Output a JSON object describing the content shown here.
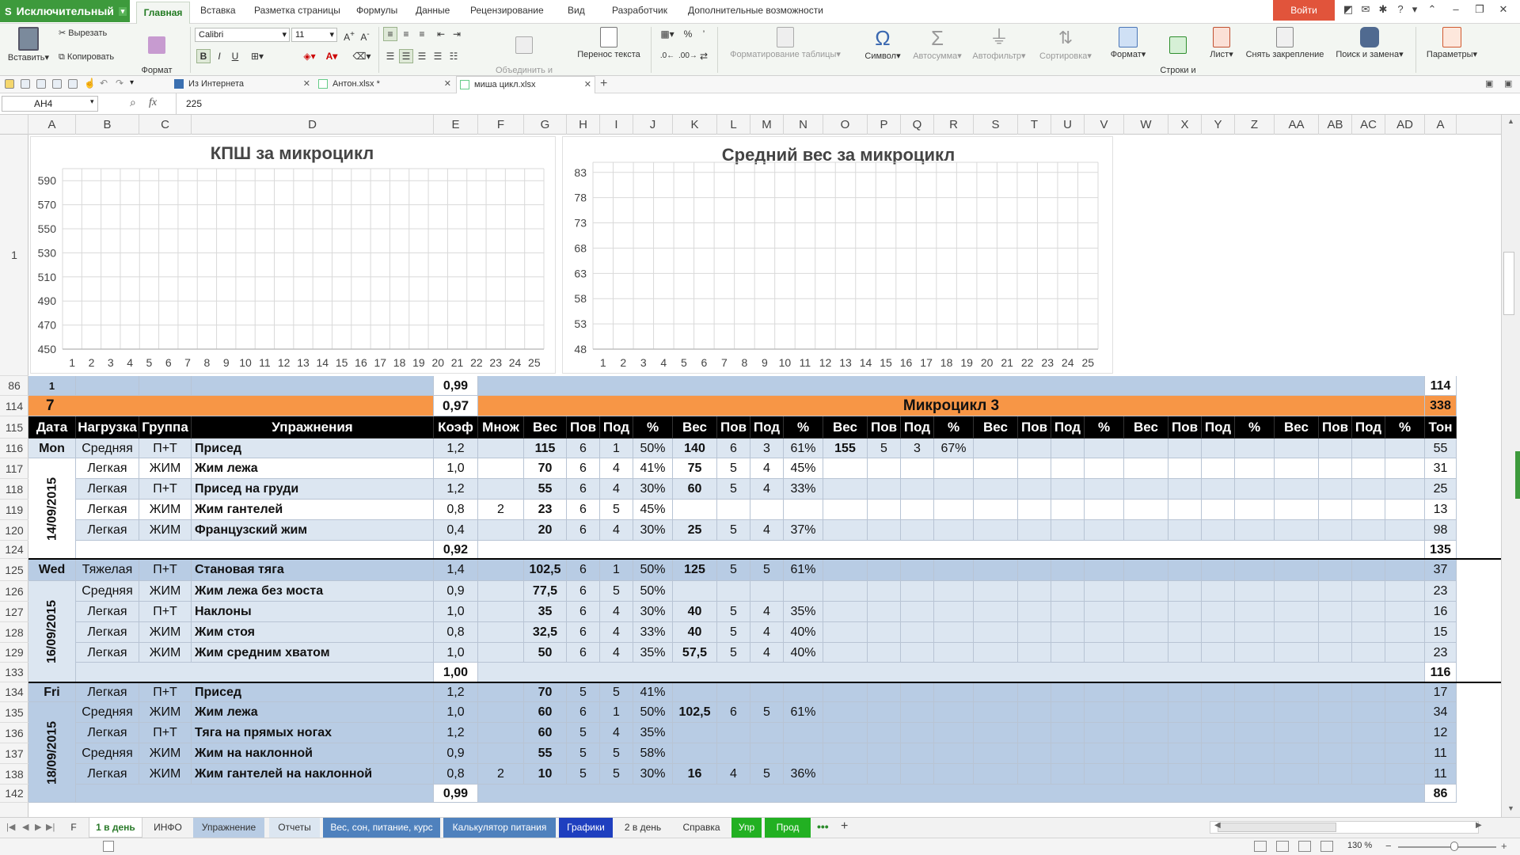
{
  "app": {
    "menu_label": "Исключительный",
    "login_label": "Войти",
    "ribbon_tabs": [
      "Главная",
      "Вставка",
      "Разметка страницы",
      "Формулы",
      "Данные",
      "Рецензирование",
      "Вид",
      "Разработчик",
      "Дополнительные возможности"
    ]
  },
  "ribbon": {
    "paste": "Вставить",
    "cut": "Вырезать",
    "copy": "Копировать",
    "format_painter": "Формат\nпо образцу",
    "font_name": "Calibri",
    "font_size": "11",
    "merge_center": "Объединить и\nпоместить в центре",
    "wrap_text": "Перенос текста",
    "table_format": "Форматирование таблицы",
    "symbol": "Символ",
    "autosum": "Автосумма",
    "autofilter": "Автофильтр",
    "sort": "Сортировка",
    "format": "Формат",
    "rows_cols": "Строки и\nстолбцы",
    "sheet": "Лист",
    "unfreeze": "Снять закрепление",
    "find_replace": "Поиск и замена",
    "params": "Параметры"
  },
  "doc_tabs": [
    {
      "label": "Из Интернета"
    },
    {
      "label": "Антон.xlsx *"
    },
    {
      "label": "миша цикл.xlsx"
    }
  ],
  "formula_bar": {
    "cell_ref": "AH4",
    "fx": "fx",
    "value": "225"
  },
  "columns": [
    "A",
    "B",
    "C",
    "D",
    "E",
    "F",
    "G",
    "H",
    "I",
    "J",
    "K",
    "L",
    "M",
    "N",
    "O",
    "P",
    "Q",
    "R",
    "S",
    "T",
    "U",
    "V",
    "W",
    "X",
    "Y",
    "Z",
    "AA",
    "AB",
    "AC",
    "AD",
    "A"
  ],
  "row_numbers": [
    "1",
    "86",
    "114",
    "115",
    "116",
    "117",
    "118",
    "119",
    "120",
    "124",
    "125",
    "126",
    "127",
    "128",
    "129",
    "133",
    "134",
    "135",
    "136",
    "137",
    "138",
    "142"
  ],
  "charts": {
    "colors": {
      "grid": "#d9d9d9",
      "axis": "#bfbfbf"
    },
    "chart_data": [
      {
        "type": "line",
        "title": "КПШ за микроцикл",
        "x": [
          1,
          2,
          3,
          4,
          5,
          6,
          7,
          8,
          9,
          10,
          11,
          12,
          13,
          14,
          15,
          16,
          17,
          18,
          19,
          20,
          21,
          22,
          23,
          24,
          25
        ],
        "yticks": [
          450,
          470,
          490,
          510,
          530,
          550,
          570,
          590
        ],
        "ylim": [
          450,
          600
        ],
        "series": []
      },
      {
        "type": "line",
        "title": "Средний вес за микроцикл",
        "x": [
          1,
          2,
          3,
          4,
          5,
          6,
          7,
          8,
          9,
          10,
          11,
          12,
          13,
          14,
          15,
          16,
          17,
          18,
          19,
          20,
          21,
          22,
          23,
          24,
          25
        ],
        "yticks": [
          48,
          53,
          58,
          63,
          68,
          73,
          78,
          83
        ],
        "ylim": [
          48,
          85
        ],
        "series": []
      }
    ]
  },
  "table": {
    "row86": {
      "a": "1",
      "e": "0,99",
      "last": "114"
    },
    "row114": {
      "num": "7",
      "koef": "0,97",
      "title": "Микроцикл 3",
      "last": "338"
    },
    "header": [
      "Дата",
      "Нагрузка",
      "Группа",
      "Упражнения",
      "Коэф",
      "Множ",
      "Вес",
      "Пов",
      "Под",
      "%",
      "Вес",
      "Пов",
      "Под",
      "%",
      "Вес",
      "Пов",
      "Под",
      "%",
      "Вес",
      "Пов",
      "Под",
      "%",
      "Вес",
      "Пов",
      "Под",
      "%",
      "Вес",
      "Пов",
      "Под",
      "%",
      "Тон"
    ],
    "days": [
      {
        "day": "Mon",
        "date": "14/09/2015",
        "rows": [
          {
            "load": "Средняя",
            "group": "П+Т",
            "ex": "Присед",
            "k": "1,2",
            "m": "",
            "s1": [
              "115",
              "6",
              "1",
              "50%"
            ],
            "s2": [
              "140",
              "6",
              "3",
              "61%"
            ],
            "s3": [
              "155",
              "5",
              "3",
              "67%"
            ],
            "ton": "55"
          },
          {
            "load": "Легкая",
            "group": "ЖИМ",
            "ex": "Жим лежа",
            "k": "1,0",
            "m": "",
            "s1": [
              "70",
              "6",
              "4",
              "41%"
            ],
            "s2": [
              "75",
              "5",
              "4",
              "45%"
            ],
            "s3": [
              "",
              "",
              "",
              ""
            ],
            "ton": "31"
          },
          {
            "load": "Легкая",
            "group": "П+Т",
            "ex": "Присед на груди",
            "k": "1,2",
            "m": "",
            "s1": [
              "55",
              "6",
              "4",
              "30%"
            ],
            "s2": [
              "60",
              "5",
              "4",
              "33%"
            ],
            "s3": [
              "",
              "",
              "",
              ""
            ],
            "ton": "25"
          },
          {
            "load": "Легкая",
            "group": "ЖИМ",
            "ex": "Жим гантелей",
            "k": "0,8",
            "m": "2",
            "s1": [
              "23",
              "6",
              "5",
              "45%"
            ],
            "s2": [
              "",
              "",
              "",
              ""
            ],
            "s3": [
              "",
              "",
              "",
              ""
            ],
            "ton": "13"
          },
          {
            "load": "Легкая",
            "group": "ЖИМ",
            "ex": "Французский жим",
            "k": "0,4",
            "m": "",
            "s1": [
              "20",
              "6",
              "4",
              "30%"
            ],
            "s2": [
              "25",
              "5",
              "4",
              "37%"
            ],
            "s3": [
              "",
              "",
              "",
              ""
            ],
            "ton": "98"
          }
        ],
        "total_k": "0,92",
        "total_ton": "135"
      },
      {
        "day": "Wed",
        "date": "16/09/2015",
        "rows": [
          {
            "load": "Тяжелая",
            "group": "П+Т",
            "ex": "Становая тяга",
            "k": "1,4",
            "m": "",
            "s1": [
              "102,5",
              "6",
              "1",
              "50%"
            ],
            "s2": [
              "125",
              "5",
              "5",
              "61%"
            ],
            "s3": [
              "",
              "",
              "",
              ""
            ],
            "ton": "37"
          },
          {
            "load": "Средняя",
            "group": "ЖИМ",
            "ex": "Жим лежа без моста",
            "k": "0,9",
            "m": "",
            "s1": [
              "77,5",
              "6",
              "5",
              "50%"
            ],
            "s2": [
              "",
              "",
              "",
              ""
            ],
            "s3": [
              "",
              "",
              "",
              ""
            ],
            "ton": "23"
          },
          {
            "load": "Легкая",
            "group": "П+Т",
            "ex": "Наклоны",
            "k": "1,0",
            "m": "",
            "s1": [
              "35",
              "6",
              "4",
              "30%"
            ],
            "s2": [
              "40",
              "5",
              "4",
              "35%"
            ],
            "s3": [
              "",
              "",
              "",
              ""
            ],
            "ton": "16"
          },
          {
            "load": "Легкая",
            "group": "ЖИМ",
            "ex": "Жим стоя",
            "k": "0,8",
            "m": "",
            "s1": [
              "32,5",
              "6",
              "4",
              "33%"
            ],
            "s2": [
              "40",
              "5",
              "4",
              "40%"
            ],
            "s3": [
              "",
              "",
              "",
              ""
            ],
            "ton": "15"
          },
          {
            "load": "Легкая",
            "group": "ЖИМ",
            "ex": "Жим средним хватом",
            "k": "1,0",
            "m": "",
            "s1": [
              "50",
              "6",
              "4",
              "35%"
            ],
            "s2": [
              "57,5",
              "5",
              "4",
              "40%"
            ],
            "s3": [
              "",
              "",
              "",
              ""
            ],
            "ton": "23"
          }
        ],
        "total_k": "1,00",
        "total_ton": "116"
      },
      {
        "day": "Fri",
        "date": "18/09/2015",
        "rows": [
          {
            "load": "Легкая",
            "group": "П+Т",
            "ex": "Присед",
            "k": "1,2",
            "m": "",
            "s1": [
              "70",
              "5",
              "5",
              "41%"
            ],
            "s2": [
              "",
              "",
              "",
              ""
            ],
            "s3": [
              "",
              "",
              "",
              ""
            ],
            "ton": "17"
          },
          {
            "load": "Средняя",
            "group": "ЖИМ",
            "ex": "Жим лежа",
            "k": "1,0",
            "m": "",
            "s1": [
              "60",
              "6",
              "1",
              "50%"
            ],
            "s2": [
              "102,5",
              "6",
              "5",
              "61%"
            ],
            "s3": [
              "",
              "",
              "",
              ""
            ],
            "ton": "34"
          },
          {
            "load": "Легкая",
            "group": "П+Т",
            "ex": "Тяга на прямых ногах",
            "k": "1,2",
            "m": "",
            "s1": [
              "60",
              "5",
              "4",
              "35%"
            ],
            "s2": [
              "",
              "",
              "",
              ""
            ],
            "s3": [
              "",
              "",
              "",
              ""
            ],
            "ton": "12"
          },
          {
            "load": "Средняя",
            "group": "ЖИМ",
            "ex": "Жим на наклонной",
            "k": "0,9",
            "m": "",
            "s1": [
              "55",
              "5",
              "5",
              "58%"
            ],
            "s2": [
              "",
              "",
              "",
              ""
            ],
            "s3": [
              "",
              "",
              "",
              ""
            ],
            "ton": "11"
          },
          {
            "load": "Легкая",
            "group": "ЖИМ",
            "ex": "Жим гантелей на наклонной",
            "k": "0,8",
            "m": "2",
            "s1": [
              "10",
              "5",
              "5",
              "30%"
            ],
            "s2": [
              "16",
              "4",
              "5",
              "36%"
            ],
            "s3": [
              "",
              "",
              "",
              ""
            ],
            "ton": "11"
          }
        ],
        "total_k": "0,99",
        "total_ton": "86"
      }
    ]
  },
  "sheet_tabs": [
    {
      "label": "F",
      "color": "#f2f2f2",
      "text": "#333"
    },
    {
      "label": "1 в день",
      "color": "#ffffff",
      "text": "#2a7a2a"
    },
    {
      "label": "ИНФО",
      "color": "#f2f2f2",
      "text": "#333"
    },
    {
      "label": "Упражнение",
      "color": "#b8cce4",
      "text": "#333"
    },
    {
      "label": "Отчеты",
      "color": "#dce6f1",
      "text": "#333"
    },
    {
      "label": "Вес, сон, питание, курс",
      "color": "#4f81bd",
      "text": "#ffffff"
    },
    {
      "label": "Калькулятор питания",
      "color": "#4f81bd",
      "text": "#ffffff"
    },
    {
      "label": "Графики",
      "color": "#1f3fbf",
      "text": "#ffffff"
    },
    {
      "label": "2 в день",
      "color": "#f2f2f2",
      "text": "#333"
    },
    {
      "label": "Справка",
      "color": "#f2f2f2",
      "text": "#333"
    },
    {
      "label": "Упр",
      "color": "#22b022",
      "text": "#ffffff"
    },
    {
      "label": "Прод",
      "color": "#22b022",
      "text": "#ffffff"
    }
  ],
  "tabs_more": "•••",
  "tabs_add": "+",
  "status": {
    "zoom": "130 %"
  }
}
